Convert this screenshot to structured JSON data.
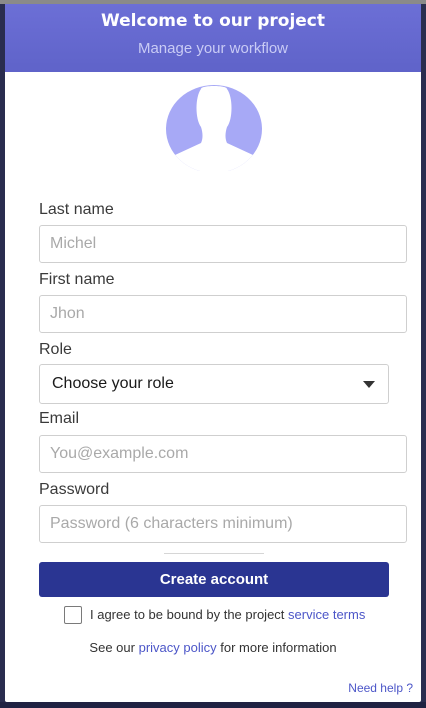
{
  "header": {
    "title": "Welcome to our project",
    "subtitle": "Manage your workflow"
  },
  "form": {
    "last_name": {
      "label": "Last name",
      "placeholder": "Michel",
      "value": ""
    },
    "first_name": {
      "label": "First name",
      "placeholder": "Jhon",
      "value": ""
    },
    "role": {
      "label": "Role",
      "selected": "Choose your role"
    },
    "email": {
      "label": "Email",
      "placeholder": "You@example.com",
      "value": ""
    },
    "password": {
      "label": "Password",
      "placeholder": "Password (6 characters minimum)",
      "value": ""
    }
  },
  "actions": {
    "create_label": "Create account"
  },
  "terms": {
    "text": "I agree to be bound by the project",
    "link": "service terms",
    "checked": false
  },
  "privacy": {
    "prefix": "See our",
    "link": "privacy policy",
    "suffix": "for more information"
  },
  "help": {
    "label": "Need help ?"
  },
  "icons": {
    "avatar": "user-silhouette-icon",
    "dropdown": "caret-down-icon"
  },
  "colors": {
    "header_bg": "#6468d0",
    "avatar_bg": "#a7a9f6",
    "button_bg": "#2a3592",
    "link": "#4c56c8",
    "page_bg": "#2a2d4f"
  }
}
